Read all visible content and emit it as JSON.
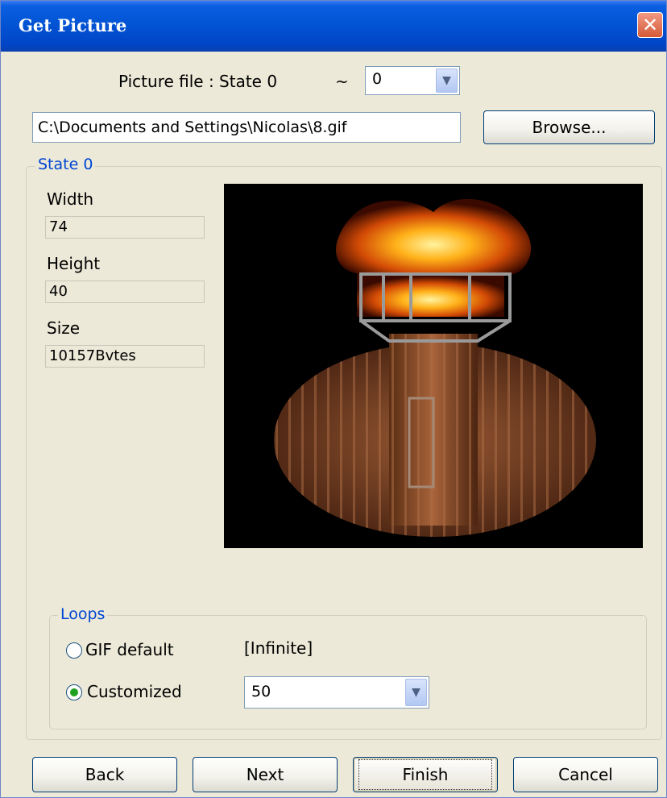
{
  "window": {
    "title": "Get Picture"
  },
  "picture_file": {
    "label": "Picture file : State 0",
    "tilde": "~",
    "state_selected": "0",
    "path": "C:\\Documents and Settings\\Nicolas\\8.gif",
    "browse_label": "Browse..."
  },
  "state_group": {
    "legend": "State 0",
    "width_label": "Width",
    "width_value": "74",
    "height_label": "Height",
    "height_value": "40",
    "size_label": "Size",
    "size_value": "10157Bvtes"
  },
  "loops": {
    "legend": "Loops",
    "gif_default_label": "GIF default",
    "gif_default_value": "[Infinite]",
    "customized_label": "Customized",
    "customized_value": "50",
    "selected": "customized"
  },
  "buttons": {
    "back": "Back",
    "next": "Next",
    "finish": "Finish",
    "cancel": "Cancel"
  }
}
